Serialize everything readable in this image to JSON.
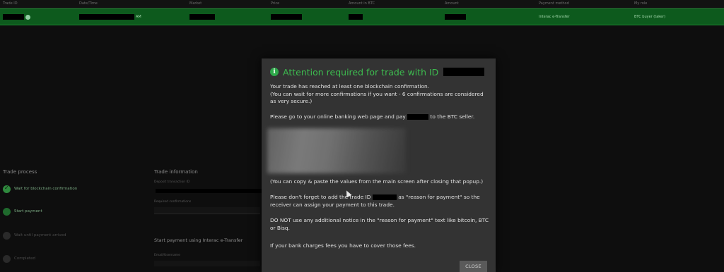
{
  "table": {
    "headers": [
      "Trade ID",
      "Date/Time",
      "Market",
      "Price",
      "Amount in BTC",
      "Amount",
      "Payment method",
      "My role"
    ],
    "row": {
      "date_suffix": "AM",
      "payment_method": "Interac e-Transfer",
      "role": "BTC buyer (taker)"
    }
  },
  "trade_process": {
    "title": "Trade process",
    "steps": [
      {
        "label": "Wait for blockchain confirmation",
        "state": "done"
      },
      {
        "label": "Start payment",
        "state": "active"
      },
      {
        "label": "Wait until payment arrived",
        "state": "pending"
      },
      {
        "label": "Completed",
        "state": "pending"
      }
    ]
  },
  "trade_information": {
    "title": "Trade information",
    "fields": [
      {
        "label": "Deposit transaction ID"
      },
      {
        "label": "Required confirmations"
      }
    ],
    "payment_title": "Start payment using Interac e-Transfer",
    "payment_field": "Email/Username"
  },
  "modal": {
    "title": "Attention required for trade with ID",
    "para1": "Your trade has reached at least one blockchain confirmation.",
    "para1b": "(You can wait for more confirmations if you want - 6 confirmations are considered as very secure.)",
    "para2_a": "Please go to your online banking web page and pay",
    "para2_b": "to the BTC seller.",
    "para3": "(You can copy & paste the values from the main screen after closing that popup.)",
    "para4_a": "Please don't forget to add the trade ID",
    "para4_b": "as \"reason for payment\" so the receiver can assign your payment to this trade.",
    "para5": "DO NOT use any additional notice in the \"reason for payment\" text like bitcoin, BTC or Bisq.",
    "para6": "If your bank charges fees you have to cover those fees.",
    "close_label": "CLOSE"
  },
  "colors": {
    "accent": "#3dbb4f",
    "selected_row": "#0d5a1d",
    "modal_bg": "#333333",
    "background": "#0e0e0e"
  }
}
